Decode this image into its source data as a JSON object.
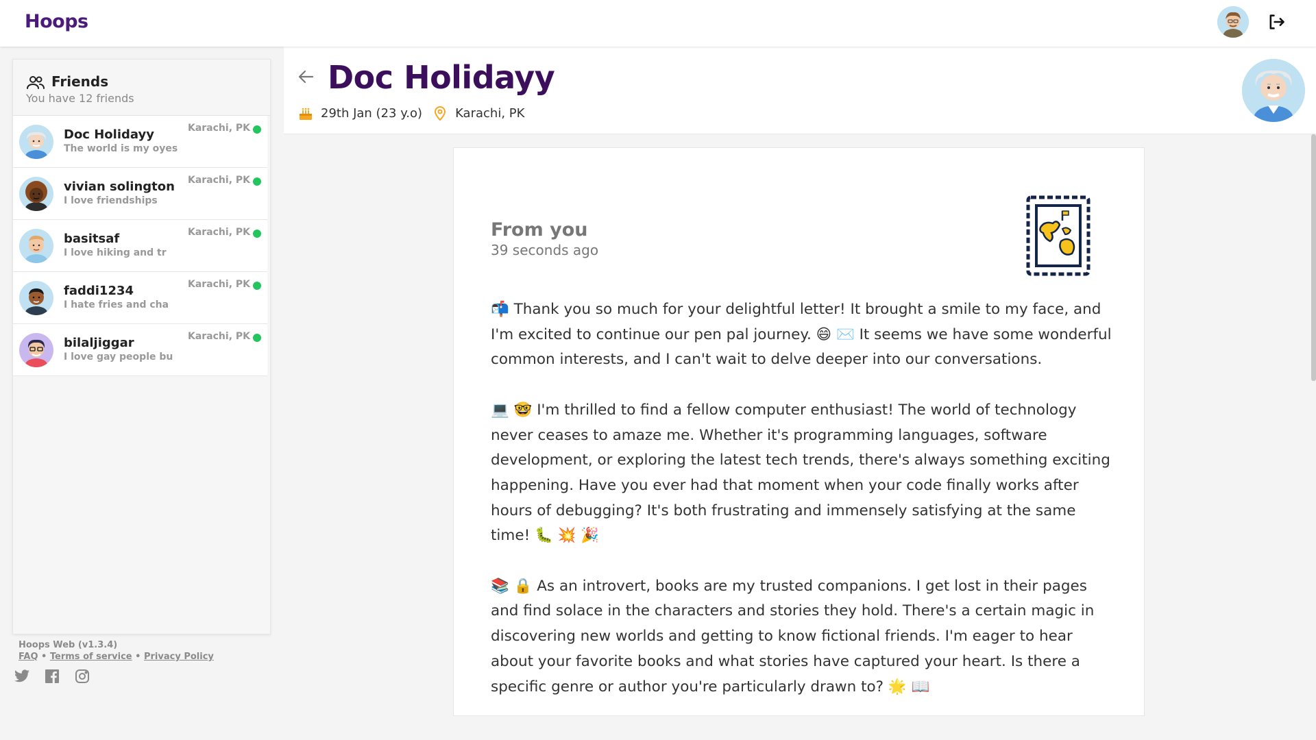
{
  "app": {
    "name": "Hoops"
  },
  "header": {
    "user_avatar_icon": "user-avatar-icon",
    "logout_icon": "logout-icon"
  },
  "sidebar": {
    "title": "Friends",
    "subtitle": "You have 12 friends",
    "friends": [
      {
        "name": "Doc Holidayy",
        "status": "The world is my oyes",
        "location": "Karachi, PK",
        "online": true
      },
      {
        "name": "vivian solington",
        "status": "I love friendships",
        "location": "Karachi, PK",
        "online": true
      },
      {
        "name": "basitsaf",
        "status": "I love hiking and tr",
        "location": "Karachi, PK",
        "online": true
      },
      {
        "name": "faddi1234",
        "status": "I hate fries and cha",
        "location": "Karachi, PK",
        "online": true
      },
      {
        "name": "bilaljiggar",
        "status": "I love gay people bu",
        "location": "Karachi, PK",
        "online": true
      }
    ],
    "online_color": "#22c55e"
  },
  "footer": {
    "version": "Hoops Web (v1.3.4)",
    "links": [
      "FAQ",
      "Terms of service",
      "Privacy Policy"
    ],
    "separator": "•",
    "socials": [
      "twitter-icon",
      "facebook-icon",
      "instagram-icon"
    ]
  },
  "profile": {
    "name": "Doc Holidayy",
    "birthday": "29th Jan (23 y.o)",
    "location": "Karachi, PK"
  },
  "letter": {
    "from": "From you",
    "time": "39 seconds ago",
    "paragraphs": [
      "📬 Thank you so much for your delightful letter! It brought a smile to my face, and I'm excited to continue our pen pal journey. 😄 ✉️ It seems we have some wonderful common interests, and I can't wait to delve deeper into our conversations.",
      "💻 🤓 I'm thrilled to find a fellow computer enthusiast! The world of technology never ceases to amaze me. Whether it's programming languages, software development, or exploring the latest tech trends, there's always something exciting happening. Have you ever had that moment when your code finally works after hours of debugging? It's both frustrating and immensely satisfying at the same time! 🐛 💥 🎉",
      "📚 🔒 As an introvert, books are my trusted companions. I get lost in their pages and find solace in the characters and stories they hold. There's a certain magic in discovering new worlds and getting to know fictional friends. I'm eager to hear about your favorite books and what stories have captured your heart. Is there a specific genre or author you're particularly drawn to? 🌟 📖"
    ]
  },
  "colors": {
    "brand": "#4b1a7a",
    "title": "#3b0f5c",
    "accent_orange": "#f5a623"
  }
}
